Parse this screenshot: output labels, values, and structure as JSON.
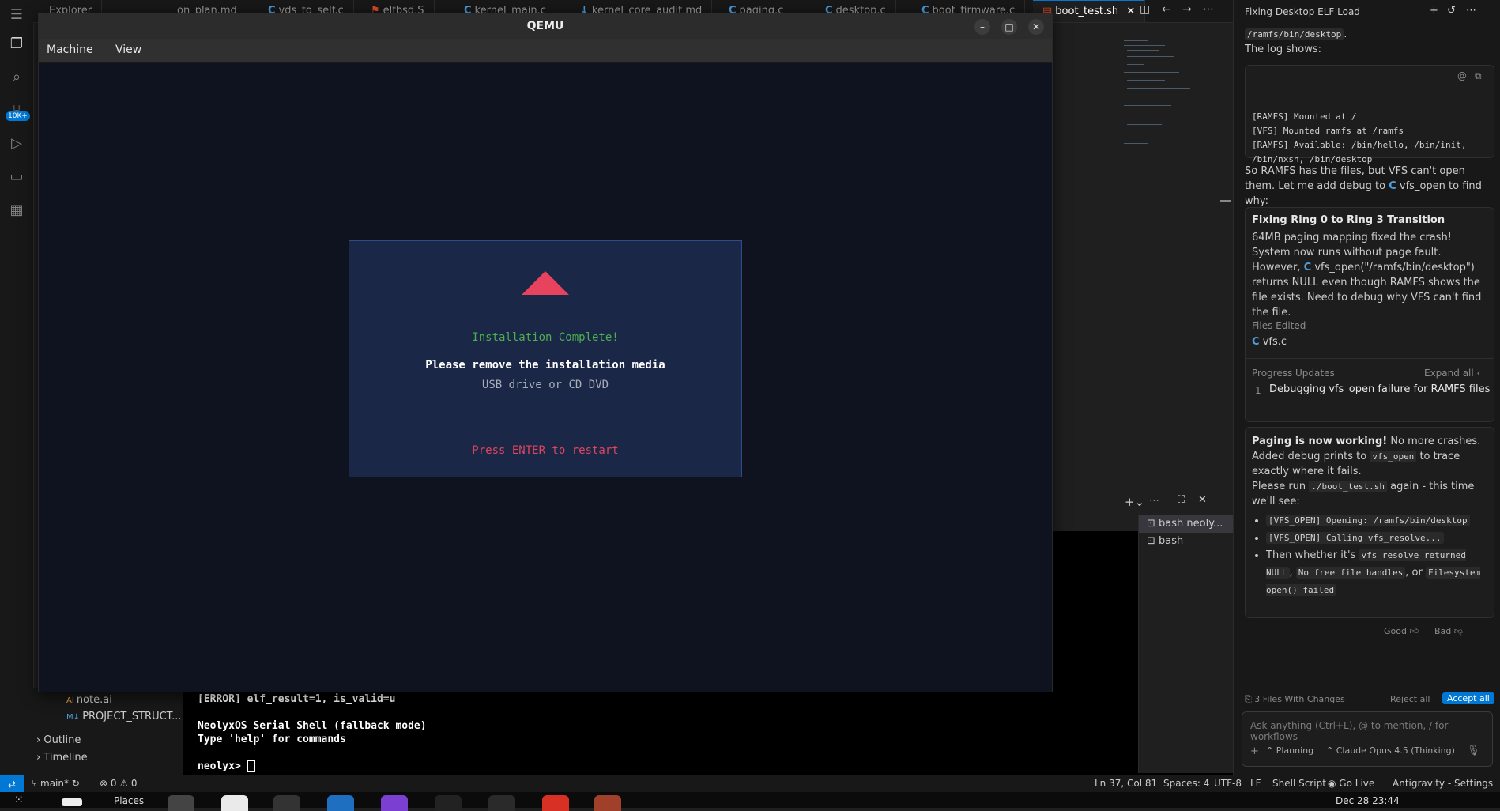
{
  "tabs": [
    {
      "label": "Explorer",
      "type": "plain"
    },
    {
      "label": "on_plan.md",
      "type": "md"
    },
    {
      "label": "vds_to_self.c",
      "type": "c"
    },
    {
      "label": "elfbsd.S",
      "type": "asm"
    },
    {
      "label": "kernel_main.c",
      "type": "c"
    },
    {
      "label": "kernel_core_audit.md",
      "type": "md"
    },
    {
      "label": "paging.c",
      "type": "c"
    },
    {
      "label": "desktop.c",
      "type": "c"
    },
    {
      "label": "boot_firmware.c",
      "type": "c"
    },
    {
      "label": "boot_test.sh",
      "type": "sh"
    }
  ],
  "activity_badge": "10K+",
  "qemu": {
    "title": "QEMU",
    "menu": [
      "Machine",
      "View"
    ],
    "dialog": {
      "heading": "Installation Complete!",
      "line1": "Please remove the installation media",
      "line2": "USB drive or CD DVD",
      "prompt": "Press ENTER to restart"
    }
  },
  "terminal": {
    "lines": [
      "[ERROR] elf_result=1, is_valid=u",
      "",
      "NeolyxOS Serial Shell (fallback mode)",
      "Type 'help' for commands",
      "",
      "neolyx> "
    ],
    "sessions": [
      "bash neoly...",
      "bash"
    ]
  },
  "explorer": {
    "files": [
      "note.ai",
      "PROJECT_STRUCT..."
    ],
    "sections": [
      "Outline",
      "Timeline"
    ]
  },
  "statusbar": {
    "branch": "main*",
    "problems": "0",
    "warnings": "0",
    "position": "Ln 37, Col 81",
    "spaces": "Spaces: 4",
    "encoding": "UTF-8",
    "eol": "LF",
    "language": "Shell Script",
    "golive": "Go Live",
    "settings": "Antigravity - Settings"
  },
  "taskbar": {
    "places": "Places",
    "datetime": "Dec 28  23:44"
  },
  "chat": {
    "title": "Fixing Desktop ELF Load",
    "top_path": "/ramfs/bin/desktop",
    "log_intro": "The log shows:",
    "log_lines": [
      "[RAMFS] Mounted at /",
      "[VFS] Mounted ramfs at /ramfs",
      "[RAMFS] Available: /bin/hello, /bin/init,",
      "/bin/nxsh, /bin/desktop"
    ],
    "para1a": "So RAMFS has the files, but VFS can't open them. Let me add debug to",
    "para1_code": "vfs_open",
    "para1b": "to find why:",
    "task_title": "Fixing Ring 0 to Ring 3 Transition",
    "task_body1": "64MB paging mapping fixed the crash! System now runs without page fault. However,",
    "task_code": "vfs_open(\"/ramfs/bin/desktop\")",
    "task_body2": "returns NULL even though RAMFS shows the file exists. Need to debug why VFS can't find the file.",
    "files_edited_label": "Files Edited",
    "files_edited": "vfs.c",
    "progress_label": "Progress Updates",
    "expand_all": "Expand all",
    "progress_num": "1",
    "progress_item": "Debugging vfs_open failure for RAMFS files",
    "msg_bold": "Paging is now working!",
    "msg_rest": " No more crashes. Added debug prints to",
    "msg_code1": "vfs_open",
    "msg_rest2": "to trace exactly where it fails.",
    "msg_run_a": "Please run",
    "msg_run_code": "./boot_test.sh",
    "msg_run_b": "again - this time we'll see:",
    "bullets": [
      "[VFS_OPEN] Opening: /ramfs/bin/desktop",
      "[VFS_OPEN] Calling vfs_resolve..."
    ],
    "bullet3_a": "Then whether it's",
    "bullet3_codes": [
      "vfs_resolve returned NULL",
      "No free file handles",
      "Filesystem open() failed"
    ],
    "bullet3_or": "or",
    "good": "Good",
    "bad": "Bad",
    "changes": "3 Files With Changes",
    "reject": "Reject all",
    "accept": "Accept all",
    "input_placeholder": "Ask anything (Ctrl+L), @ to mention, / for workflows",
    "mode": "Planning",
    "model": "Claude Opus 4.5 (Thinking)"
  },
  "colors": {
    "accent": "#0078d4",
    "dialog_heading": "#4caf50",
    "dialog_prompt": "#e0455f",
    "triangle": "#e8435e"
  }
}
